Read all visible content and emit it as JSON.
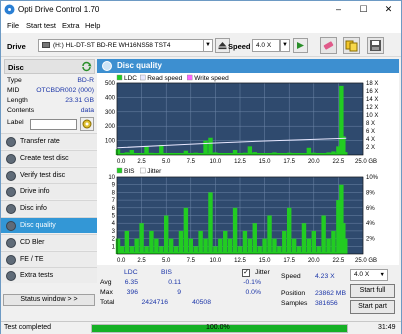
{
  "window": {
    "title": "Opti Drive Control 1.70",
    "minimize": "–",
    "maximize": "☐",
    "close": "✕"
  },
  "menu": [
    "File",
    "Start test",
    "Extra",
    "Help"
  ],
  "toolbar": {
    "drive_label": "Drive",
    "drive_value": "(H:)  HL-DT-ST BD-RE  WH16NS58 TST4",
    "speed_label": "Speed",
    "speed_value": "4.0 X"
  },
  "disc": {
    "header": "Disc",
    "fields": [
      {
        "key": "Type",
        "value": "BD-R"
      },
      {
        "key": "MID",
        "value": "OTCBDR002 (000)"
      },
      {
        "key": "Length",
        "value": "23.31 GB"
      },
      {
        "key": "Contents",
        "value": "data"
      },
      {
        "key": "Label",
        "value": ""
      }
    ]
  },
  "nav": [
    {
      "label": "Transfer rate",
      "active": false
    },
    {
      "label": "Create test disc",
      "active": false
    },
    {
      "label": "Verify test disc",
      "active": false
    },
    {
      "label": "Drive info",
      "active": false
    },
    {
      "label": "Disc info",
      "active": false
    },
    {
      "label": "Disc quality",
      "active": true
    },
    {
      "label": "CD Bler",
      "active": false
    },
    {
      "label": "FE / TE",
      "active": false
    },
    {
      "label": "Extra tests",
      "active": false
    }
  ],
  "status_window_btn": "Status window > >",
  "panel_title": "Disc quality",
  "chart_data": [
    {
      "type": "area",
      "legend": [
        "LDC",
        "Read speed",
        "Write speed"
      ],
      "x_ticks": [
        "0.0",
        "2.5",
        "5.0",
        "7.5",
        "10.0",
        "12.5",
        "15.0",
        "17.5",
        "20.0",
        "22.5",
        "25.0 GB"
      ],
      "xlim": [
        0,
        25
      ],
      "y_left_ticks": [
        "100",
        "200",
        "300",
        "400",
        "500"
      ],
      "ylim_left": [
        0,
        500
      ],
      "y_right_ticks": [
        "2 X",
        "4 X",
        "6 X",
        "8 X",
        "10 X",
        "12 X",
        "14 X",
        "16 X",
        "18 X"
      ],
      "ylim_right": [
        0,
        18
      ],
      "series": [
        {
          "name": "LDC",
          "color": "#22cc22",
          "x": [
            0.1,
            0.5,
            1.0,
            1.5,
            2.0,
            2.5,
            3.0,
            3.5,
            4.0,
            4.5,
            5.0,
            5.5,
            6.0,
            6.5,
            7.0,
            7.5,
            8.0,
            8.5,
            9.0,
            9.5,
            10.0,
            10.5,
            11.0,
            11.5,
            12.0,
            12.5,
            13.0,
            13.5,
            14.0,
            14.5,
            15.0,
            15.5,
            16.0,
            16.5,
            17.0,
            17.5,
            18.0,
            18.5,
            19.0,
            19.5,
            20.0,
            20.5,
            21.0,
            21.5,
            22.0,
            22.5,
            22.8,
            23.0,
            23.2
          ],
          "y": [
            40,
            12,
            18,
            35,
            8,
            10,
            60,
            15,
            12,
            70,
            10,
            14,
            9,
            12,
            30,
            11,
            16,
            10,
            100,
            120,
            18,
            14,
            12,
            10,
            35,
            14,
            16,
            60,
            20,
            12,
            10,
            14,
            18,
            12,
            10,
            16,
            14,
            12,
            10,
            50,
            16,
            14,
            12,
            18,
            25,
            60,
            480,
            130,
            20
          ]
        },
        {
          "name": "Read speed",
          "color": "#e8e8ff",
          "x": [
            0,
            5,
            10,
            15,
            20,
            23.3
          ],
          "y": [
            1.8,
            2.4,
            3.0,
            3.5,
            3.9,
            4.2
          ]
        }
      ]
    },
    {
      "type": "area",
      "legend": [
        "BIS",
        "Jitter"
      ],
      "x_ticks": [
        "0.0",
        "2.5",
        "5.0",
        "7.5",
        "10.0",
        "12.5",
        "15.0",
        "17.5",
        "20.0",
        "22.5",
        "25.0 GB"
      ],
      "xlim": [
        0,
        25
      ],
      "y_left_ticks": [
        "1",
        "2",
        "3",
        "4",
        "5",
        "6",
        "7",
        "8",
        "9",
        "10"
      ],
      "ylim_left": [
        0,
        10
      ],
      "y_right_ticks": [
        "2%",
        "4%",
        "6%",
        "8%",
        "10%"
      ],
      "ylim_right": [
        0,
        10
      ],
      "series": [
        {
          "name": "BIS",
          "color": "#22cc22",
          "x": [
            0.1,
            0.5,
            1.0,
            1.5,
            2.0,
            2.5,
            3.0,
            3.5,
            4.0,
            4.5,
            5.0,
            5.5,
            6.0,
            6.5,
            7.0,
            7.5,
            8.0,
            8.5,
            9.0,
            9.5,
            10.0,
            10.5,
            11.0,
            11.5,
            12.0,
            12.5,
            13.0,
            13.5,
            14.0,
            14.5,
            15.0,
            15.5,
            16.0,
            16.5,
            17.0,
            17.5,
            18.0,
            18.5,
            19.0,
            19.5,
            20.0,
            20.5,
            21.0,
            21.5,
            22.0,
            22.5,
            22.8,
            23.0,
            23.2
          ],
          "y": [
            2,
            1,
            3,
            1,
            2,
            4,
            1,
            3,
            2,
            1,
            5,
            2,
            1,
            3,
            6,
            2,
            1,
            3,
            2,
            8,
            1,
            2,
            3,
            2,
            6,
            1,
            3,
            2,
            4,
            1,
            2,
            5,
            2,
            1,
            3,
            6,
            2,
            1,
            4,
            2,
            3,
            1,
            5,
            2,
            3,
            7,
            9,
            4,
            2
          ]
        }
      ]
    }
  ],
  "stats": {
    "col_headers": [
      "LDC",
      "BIS"
    ],
    "rows": [
      {
        "label": "Avg",
        "ldc": "6.35",
        "bis": "0.11",
        "jitter": "-0.1%"
      },
      {
        "label": "Max",
        "ldc": "396",
        "bis": "9",
        "jitter": "0.0%"
      },
      {
        "label": "Total",
        "ldc": "2424716",
        "bis": "40508",
        "jitter": ""
      }
    ],
    "jitter_label": "Jitter",
    "jitter_check": "✓",
    "speed_label": "Speed",
    "speed_value": "4.23 X",
    "speed_select": "4.0 X",
    "position_label": "Position",
    "position_value": "23862 MB",
    "samples_label": "Samples",
    "samples_value": "381656",
    "start_full": "Start full",
    "start_part": "Start part"
  },
  "status": {
    "text": "Test completed",
    "progress": 100.0,
    "percent_label": "100.0%",
    "time": "31:49",
    "progress_color": "#15b025"
  }
}
